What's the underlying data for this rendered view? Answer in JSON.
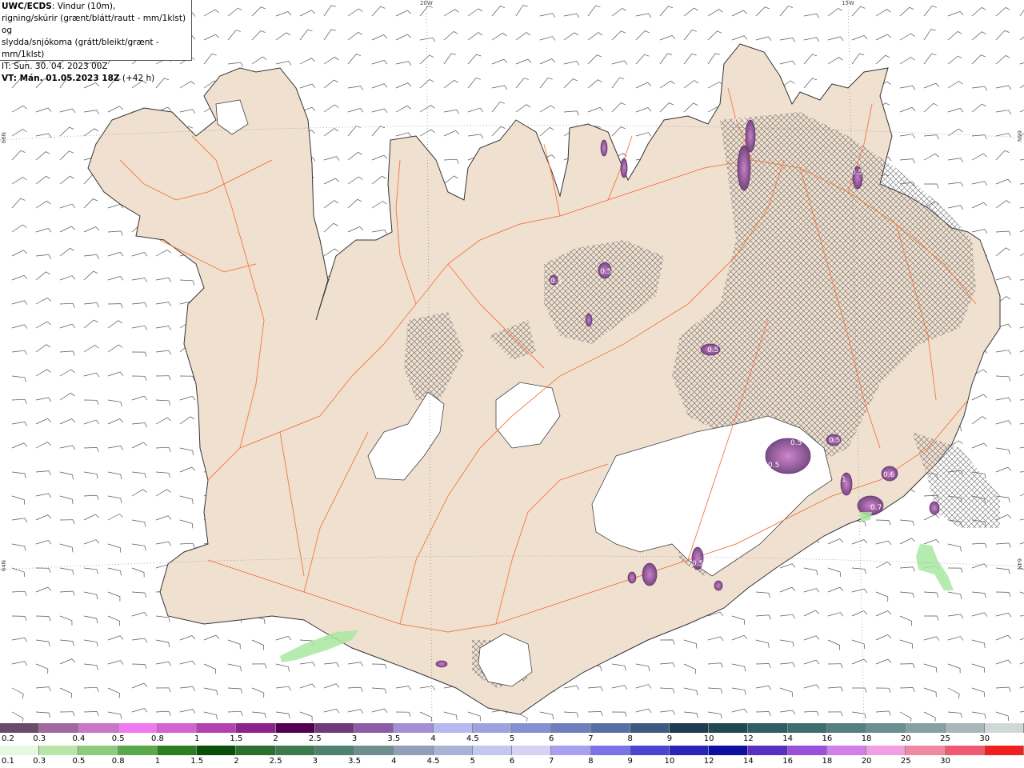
{
  "info": {
    "line1_bold": "UWC/ECDS",
    "line1_rest": ": Vindur (10m),",
    "line2": "rigning/skúrir (grænt/blátt/rautt - mm/1klst) og",
    "line3": "slydda/snjókoma (grátt/bleikt/grænt - mm/1klst)",
    "line4": "IT: Sun. 30. 04. 2023 00Z",
    "line5_bold": "VT: Mán. 01.05.2023 18Z",
    "line5_rest": " (+42 h)"
  },
  "graticule": {
    "lon_20w": "20W",
    "lon_15w": "15W",
    "lat_66n_left": "66N",
    "lat_66n_right": "66N",
    "lat_64n_left": "64N",
    "lat_64n_right": "64N"
  },
  "contour_labels": [
    "0.5",
    "0.5",
    "0.5",
    "0.5",
    "0.5",
    "0.5",
    "0.5",
    "0.5",
    "0.6",
    "0.7",
    "1",
    "0.5"
  ],
  "legend_snow": {
    "labels": [
      "0.2",
      "0.3",
      "0.4",
      "0.5",
      "0.8",
      "1",
      "1.5",
      "2",
      "2.5",
      "3",
      "3.5",
      "4",
      "4.5",
      "5",
      "6",
      "7",
      "8",
      "9",
      "10",
      "12",
      "14",
      "16",
      "18",
      "20",
      "25",
      "30"
    ],
    "colors": [
      "#6b4b6b",
      "#a2689f",
      "#c978c8",
      "#f078f0",
      "#d561d3",
      "#b440b2",
      "#8c228c",
      "#520052",
      "#6e3a7a",
      "#8c5ca6",
      "#a38fd6",
      "#b8b8f0",
      "#9ea3e0",
      "#8590d0",
      "#6f7fbd",
      "#5a6ea6",
      "#3f5a82",
      "#1e3c50",
      "#1f4a50",
      "#2d5f64",
      "#3f6e70",
      "#557f80",
      "#6b8f90",
      "#88a0a2",
      "#a8b8b8",
      "#d0d8d8"
    ]
  },
  "legend_rain": {
    "labels": [
      "0.1",
      "0.3",
      "0.5",
      "0.8",
      "1",
      "1.5",
      "2",
      "2.5",
      "3",
      "3.5",
      "4",
      "4.5",
      "5",
      "6",
      "7",
      "8",
      "9",
      "10",
      "12",
      "14",
      "16",
      "18",
      "20",
      "25",
      "30"
    ],
    "colors": [
      "#e6f8e0",
      "#b8e6a8",
      "#8ccc7c",
      "#5aa84c",
      "#2e7d24",
      "#0a500a",
      "#2e6e2e",
      "#3c7a50",
      "#4f8070",
      "#6d8f8f",
      "#8fa0b8",
      "#a9b3d6",
      "#c4c7ee",
      "#d6d2f4",
      "#a8a0f0",
      "#7c74e6",
      "#4a44d0",
      "#2a24b8",
      "#1010a0",
      "#5a30c0",
      "#9a50d8",
      "#d080e8",
      "#f0a0e0",
      "#f08aa0",
      "#f05a70",
      "#f02020"
    ]
  },
  "colors": {
    "land": "#f0e0d0",
    "coast": "#333333",
    "roads": "#f07840",
    "wind_barb": "#555555",
    "snow_hatch": "#666666",
    "glacier": "#ffffff",
    "snow_contour": "#8b4a9c",
    "rain_sea": "#a8e8a0"
  }
}
